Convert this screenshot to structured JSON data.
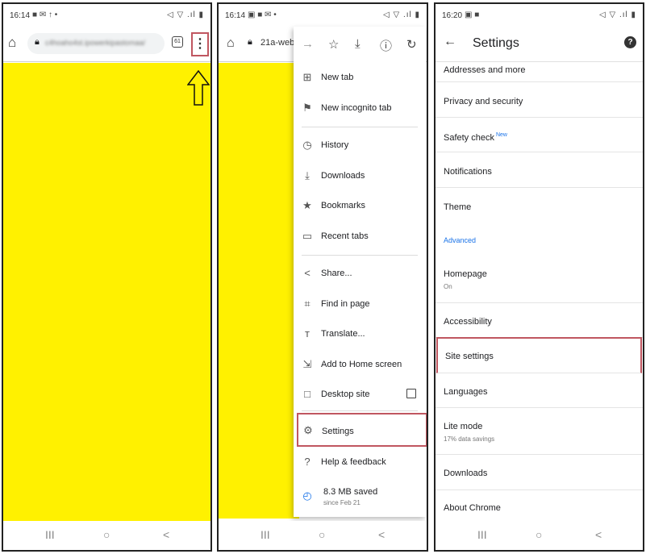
{
  "panel1": {
    "status": {
      "time": "16:14",
      "icons": "■ ✉ ↑ •",
      "right": "◁ ▽ .ıl ▮"
    },
    "url_blurred": "c4hoaho4st.ipowerkipastomaa/",
    "tabs_count": "61",
    "menu_button": "⋮"
  },
  "panel2": {
    "status": {
      "time": "16:14",
      "icons": "▣ ■ ✉ •",
      "right": "◁ ▽ .ıl ▮"
    },
    "url": "21a-web",
    "top_icons": [
      "→",
      "☆",
      "⤓",
      "ⓘ",
      "↻"
    ],
    "items": [
      {
        "icon": "⊞",
        "label": "New tab"
      },
      {
        "icon": "⚑",
        "label": "New incognito tab"
      },
      {
        "icon": "◷",
        "label": "History"
      },
      {
        "icon": "⤓",
        "label": "Downloads"
      },
      {
        "icon": "★",
        "label": "Bookmarks"
      },
      {
        "icon": "▭",
        "label": "Recent tabs"
      },
      {
        "icon": "<",
        "label": "Share..."
      },
      {
        "icon": "⌗",
        "label": "Find in page"
      },
      {
        "icon": "ᴛ",
        "label": "Translate..."
      },
      {
        "icon": "⇲",
        "label": "Add to Home screen"
      },
      {
        "icon": "□",
        "label": "Desktop site"
      },
      {
        "icon": "⚙",
        "label": "Settings"
      },
      {
        "icon": "?",
        "label": "Help & feedback"
      },
      {
        "icon": "◴",
        "label": "8.3 MB saved",
        "sub": "since Feb 21"
      }
    ]
  },
  "panel3": {
    "status": {
      "time": "16:20",
      "icons": "▣ ■",
      "right": "◁ ▽ .ıl ▮"
    },
    "title": "Settings",
    "back": "←",
    "help": "?",
    "items": [
      {
        "label": "Addresses and more"
      },
      {
        "label": "Privacy and security"
      },
      {
        "label": "Safety check",
        "badge": "New"
      },
      {
        "label": "Notifications"
      },
      {
        "label": "Theme"
      },
      {
        "label": "Homepage",
        "sub": "On"
      },
      {
        "label": "Accessibility"
      },
      {
        "label": "Site settings"
      },
      {
        "label": "Languages"
      },
      {
        "label": "Lite mode",
        "sub": "17% data savings"
      },
      {
        "label": "Downloads"
      },
      {
        "label": "About Chrome"
      }
    ],
    "advanced": "Advanced"
  },
  "navbar": {
    "recents": "III",
    "home": "○",
    "back": "<"
  },
  "colors": {
    "page": "#fff100",
    "highlight": "#c05660",
    "link": "#1a73e8"
  }
}
